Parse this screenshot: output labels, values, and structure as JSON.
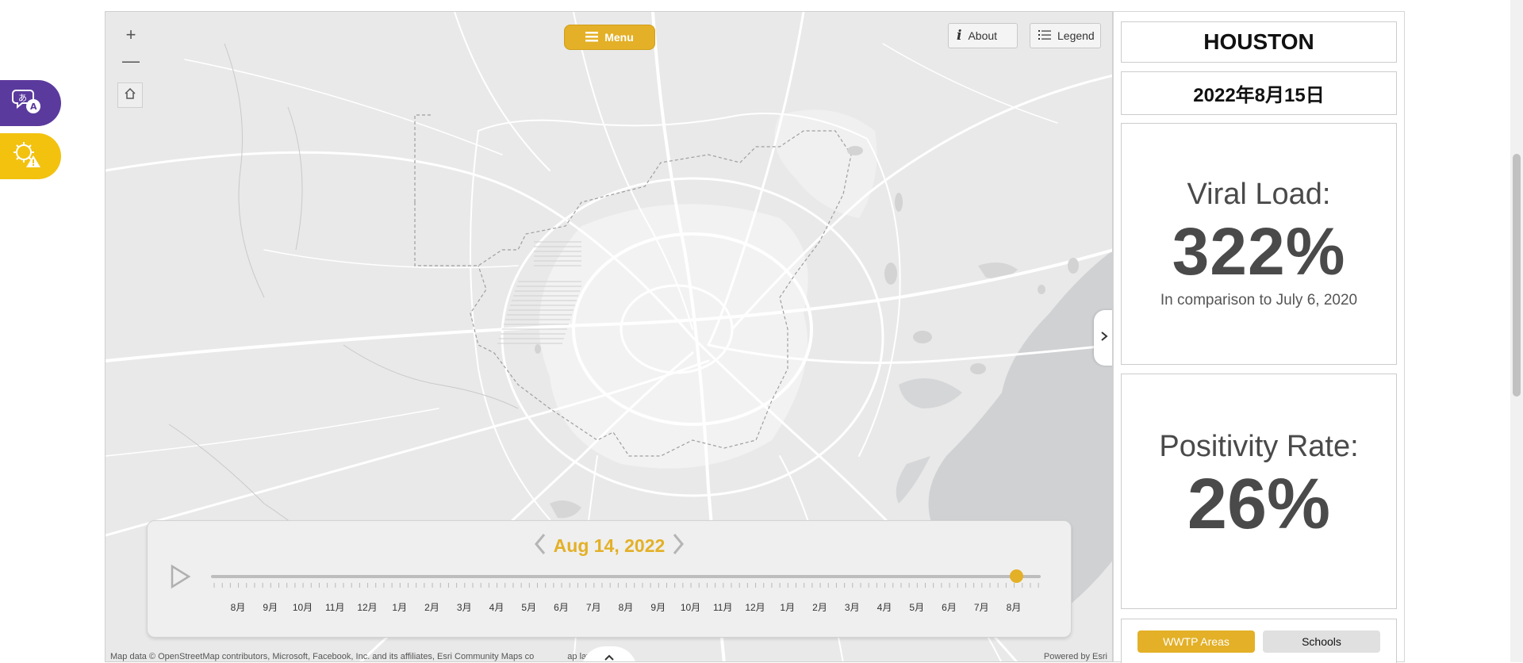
{
  "float_tabs": {
    "translate_icon": "translate-chat-icon",
    "alert_icon": "virus-alert-icon"
  },
  "map": {
    "zoom_in": "+",
    "zoom_out": "—",
    "home_icon": "home-icon",
    "menu_label": "Menu",
    "about_label": "About",
    "legend_label": "Legend",
    "attribution": "Map data © OpenStreetMap contributors, Microsoft, Facebook, Inc. and its affiliates, Esri Community Maps co",
    "attribution_tail": "ap layer by Esri",
    "powered_by": "Powered by Esri"
  },
  "time_slider": {
    "current_date": "Aug 14, 2022",
    "tick_labels": [
      "8月",
      "9月",
      "10月",
      "11月",
      "12月",
      "1月",
      "2月",
      "3月",
      "4月",
      "5月",
      "6月",
      "7月",
      "8月",
      "9月",
      "10月",
      "11月",
      "12月",
      "1月",
      "2月",
      "3月",
      "4月",
      "5月",
      "6月",
      "7月",
      "8月"
    ],
    "position_fraction": 0.97
  },
  "sidebar": {
    "city": "HOUSTON",
    "date": "2022年8月15日",
    "viral_load_label": "Viral Load:",
    "viral_load_value": "322%",
    "viral_load_note": "In comparison to July 6, 2020",
    "positivity_label": "Positivity Rate:",
    "positivity_value": "26%",
    "layer_buttons": {
      "wwtp": "WWTP Areas",
      "schools": "Schools"
    }
  },
  "colors": {
    "accent": "#e3b027",
    "translate_tab": "#5b3a9e",
    "alert_tab": "#f2c20f",
    "water": "#cfd1d3",
    "land": "#e9e9e9",
    "roads": "#ffffff"
  }
}
